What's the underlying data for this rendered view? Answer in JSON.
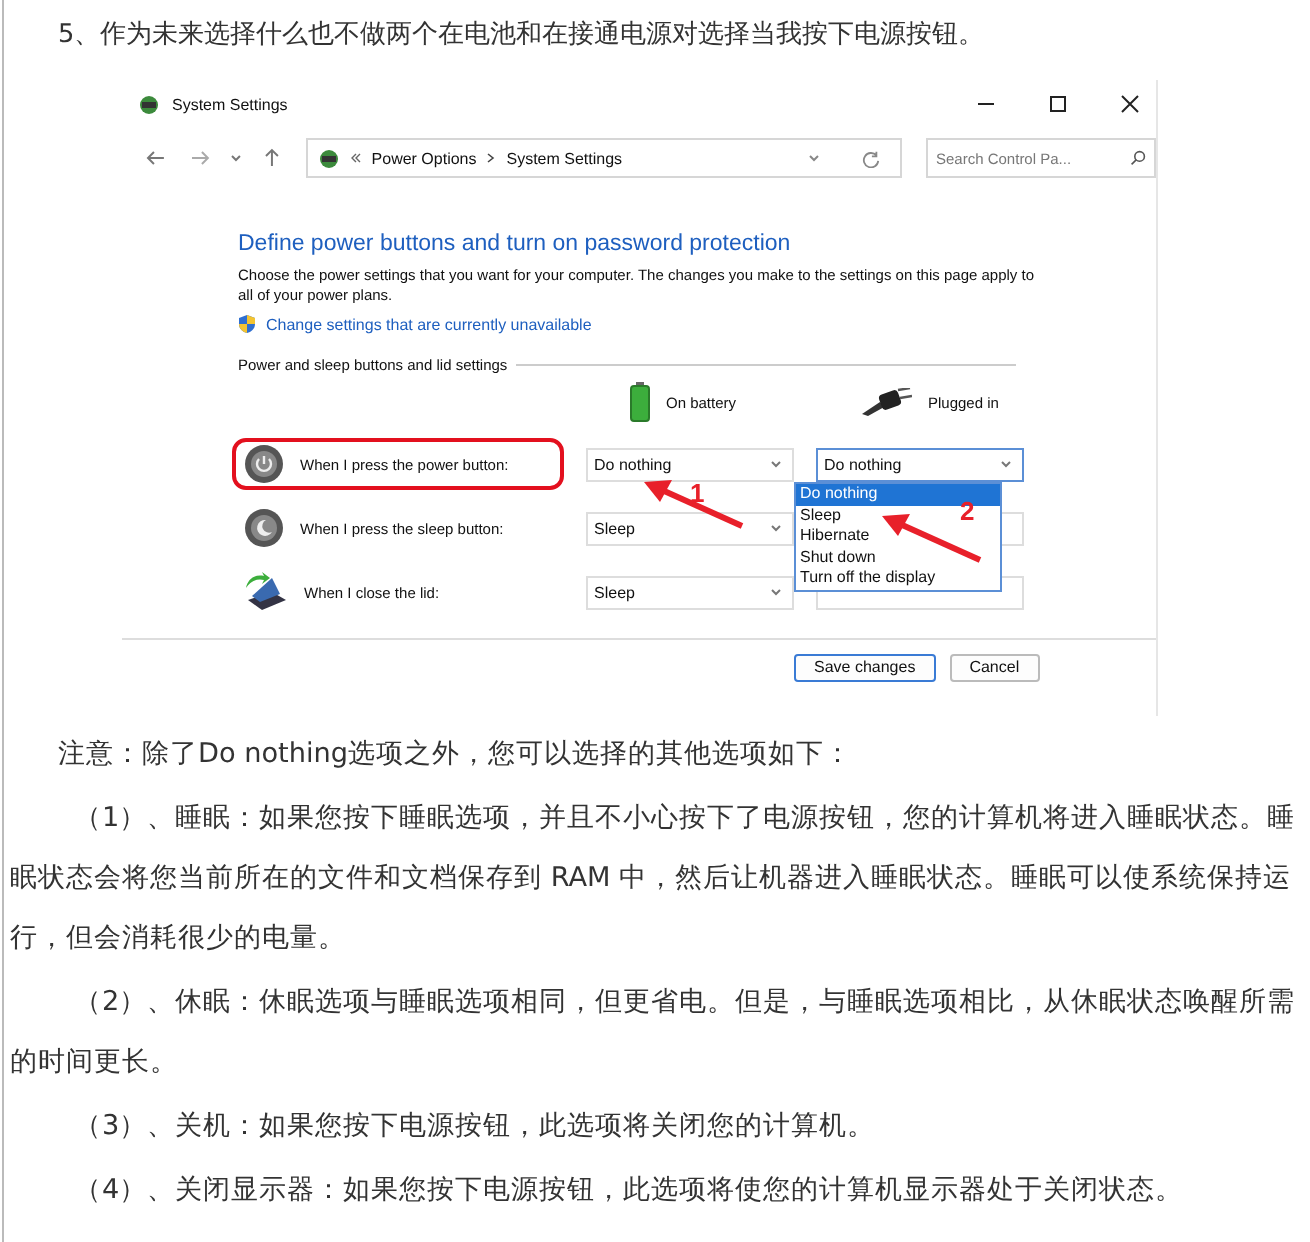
{
  "heading": "5、作为未来选择什么也不做两个在电池和在接通电源对选择当我按下电源按钮。",
  "screenshot": {
    "window": {
      "title": "System Settings"
    },
    "breadcrumb": [
      "Power Options",
      "System Settings"
    ],
    "search": {
      "placeholder": "Search Control Pa..."
    },
    "page_title": "Define power buttons and turn on password protection",
    "description": "Choose the power settings that you want for your computer. The changes you make to the settings on this page apply to all of your power plans.",
    "change_link": "Change settings that are currently unavailable",
    "section": "Power and sleep buttons and lid settings",
    "columns": [
      {
        "kind": "battery",
        "label": "On battery"
      },
      {
        "kind": "plug",
        "label": "Plugged in"
      }
    ],
    "rows": [
      {
        "kind": "power",
        "label": "When I press the power button:",
        "highlighted": true,
        "on_battery": "Do nothing",
        "plugged_in": "Do nothing"
      },
      {
        "kind": "sleep",
        "label": "When I press the sleep button:",
        "highlighted": false,
        "on_battery": "Sleep"
      },
      {
        "kind": "lid",
        "label": "When I close the lid:",
        "highlighted": false,
        "on_battery": "Sleep"
      }
    ],
    "dropdown_options": [
      {
        "label": "Do nothing",
        "selected": true
      },
      {
        "label": "Sleep",
        "selected": false
      },
      {
        "label": "Hibernate",
        "selected": false
      },
      {
        "label": "Shut down",
        "selected": false
      },
      {
        "label": "Turn off the display",
        "selected": false
      }
    ],
    "annotations": [
      {
        "label": "1"
      },
      {
        "label": "2"
      }
    ],
    "buttons": [
      "Save changes",
      "Cancel"
    ]
  },
  "note": "注意：除了Do nothing选项之外，您可以选择的其他选项如下：",
  "items": [
    "（1）、睡眠：如果您按下睡眠选项，并且不小心按下了电源按钮，您的计算机将进入睡眠状态。睡眠状态会将您当前所在的文件和文档保存到 RAM 中，然后让机器进入睡眠状态。睡眠可以使系统保持运行，但会消耗很少的电量。",
    "（2）、休眠：休眠选项与睡眠选项相同，但更省电。但是，与睡眠选项相比，从休眠状态唤醒所需的时间更长。",
    "（3）、关机：如果您按下电源按钮，此选项将关闭您的计算机。",
    "（4）、关闭显示器：如果您按下电源按钮，此选项将使您的计算机显示器处于关闭状态。"
  ]
}
